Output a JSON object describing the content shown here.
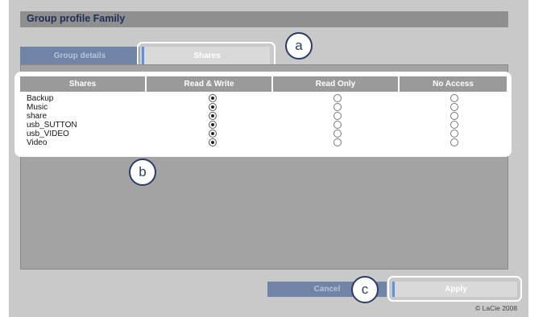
{
  "page": {
    "title": "Group profile Family"
  },
  "tabs": [
    {
      "label": "Group details",
      "active": false
    },
    {
      "label": "Shares",
      "active": true
    }
  ],
  "table": {
    "columns": [
      "Shares",
      "Read & Write",
      "Read Only",
      "No Access"
    ],
    "rows": [
      {
        "name": "Backup",
        "selected": "Read & Write"
      },
      {
        "name": "Music",
        "selected": "Read & Write"
      },
      {
        "name": "share",
        "selected": "Read & Write"
      },
      {
        "name": "usb_SUTTON",
        "selected": "Read & Write"
      },
      {
        "name": "usb_VIDEO",
        "selected": "Read & Write"
      },
      {
        "name": "Video",
        "selected": "Read & Write"
      }
    ]
  },
  "buttons": {
    "cancel_label": "Cancel",
    "apply_label": "Apply"
  },
  "callouts": {
    "a": "a",
    "b": "b",
    "c": "c"
  },
  "footer": {
    "copyright": "© LaCie 2008"
  },
  "colors": {
    "accent": "#5f8fe0",
    "callout": "#2b3d67",
    "title": "#1f2f57"
  }
}
